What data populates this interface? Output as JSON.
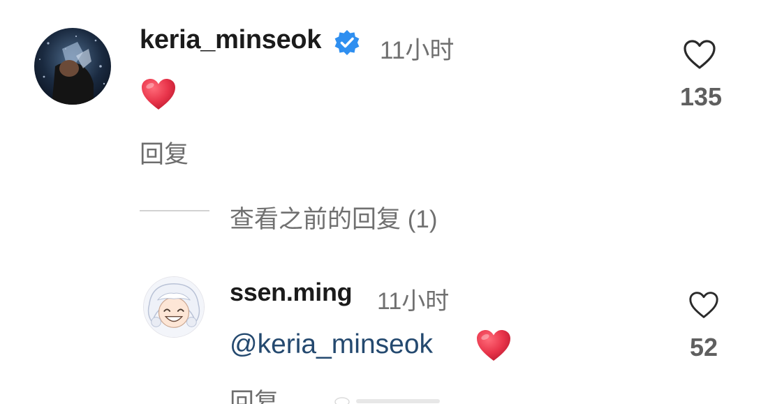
{
  "main_comment": {
    "username": "keria_minseok",
    "verified": true,
    "timestamp": "11小时",
    "content_emoji": "red-heart",
    "reply_label": "回复",
    "like_count": "135"
  },
  "view_previous": {
    "label": "查看之前的回复 (1)"
  },
  "reply_comment": {
    "username": "ssen.ming",
    "timestamp": "11小时",
    "mention": "@keria_minseok",
    "content_emoji": "red-heart",
    "reply_label": "回复",
    "like_count": "52"
  },
  "colors": {
    "text_primary": "#1b1b1b",
    "text_secondary": "#707070",
    "mention": "#24496f",
    "verified": "#2f8ff0",
    "heart": "#e8344a"
  }
}
